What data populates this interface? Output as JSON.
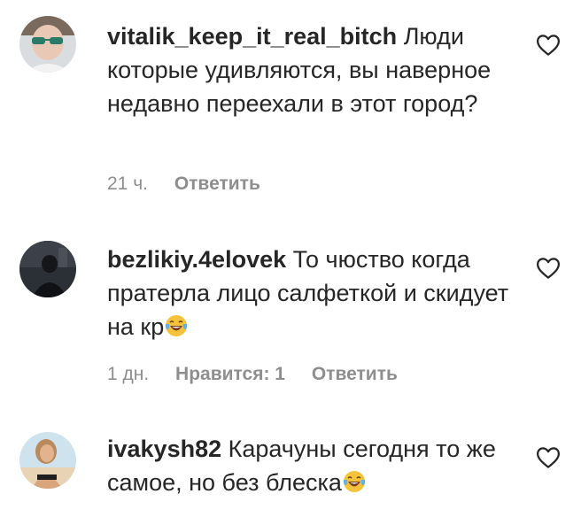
{
  "comments": [
    {
      "username": "vitalik_keep_it_real_bitch",
      "text": "Люди которые удивляются, вы наверное недавно переехали в этот город?",
      "emoji": "",
      "time": "21 ч.",
      "likes_label": "",
      "reply_label": "Ответить",
      "avatar_icon": "user-avatar-icon",
      "like_icon": "heart-outline-icon"
    },
    {
      "username": "bezlikiy.4elovek",
      "text": "То чюство когда пратерла лицо салфеткой и скидует на кр",
      "emoji": "laughing-tears-emoji",
      "time": "1 дн.",
      "likes_label": "Нравится: 1",
      "reply_label": "Ответить",
      "avatar_icon": "user-avatar-icon",
      "like_icon": "heart-outline-icon"
    },
    {
      "username": "ivakysh82",
      "text": "Карачуны сегодня то же самое, но без блеска",
      "emoji": "laughing-tears-emoji",
      "time": "",
      "likes_label": "",
      "reply_label": "",
      "avatar_icon": "user-avatar-icon",
      "like_icon": "heart-outline-icon"
    }
  ],
  "colors": {
    "text": "#262626",
    "secondary": "#8e8e8e",
    "background": "#ffffff"
  }
}
